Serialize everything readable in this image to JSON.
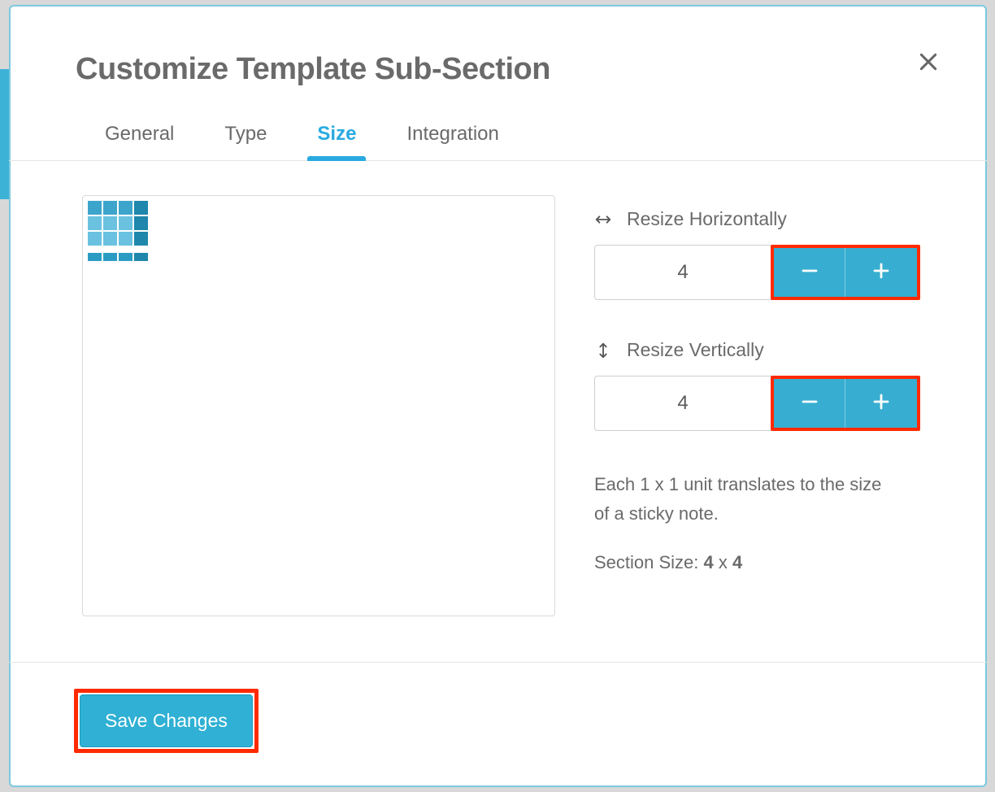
{
  "modal": {
    "title": "Customize Template Sub-Section",
    "tabs": [
      {
        "label": "General",
        "active": false
      },
      {
        "label": "Type",
        "active": false
      },
      {
        "label": "Size",
        "active": true
      },
      {
        "label": "Integration",
        "active": false
      }
    ],
    "horizontal": {
      "label": "Resize Horizontally",
      "value": "4"
    },
    "vertical": {
      "label": "Resize Vertically",
      "value": "4"
    },
    "help_text": "Each 1 x 1 unit translates to the size of a sticky note.",
    "section_size_prefix": "Section Size: ",
    "section_size_w": "4",
    "section_size_sep": " x ",
    "section_size_h": "4",
    "save_label": "Save Changes",
    "grid": {
      "cols": 4,
      "rows": 4
    }
  },
  "colors": {
    "accent": "#29aae1",
    "highlight_border": "#ff2a00"
  }
}
